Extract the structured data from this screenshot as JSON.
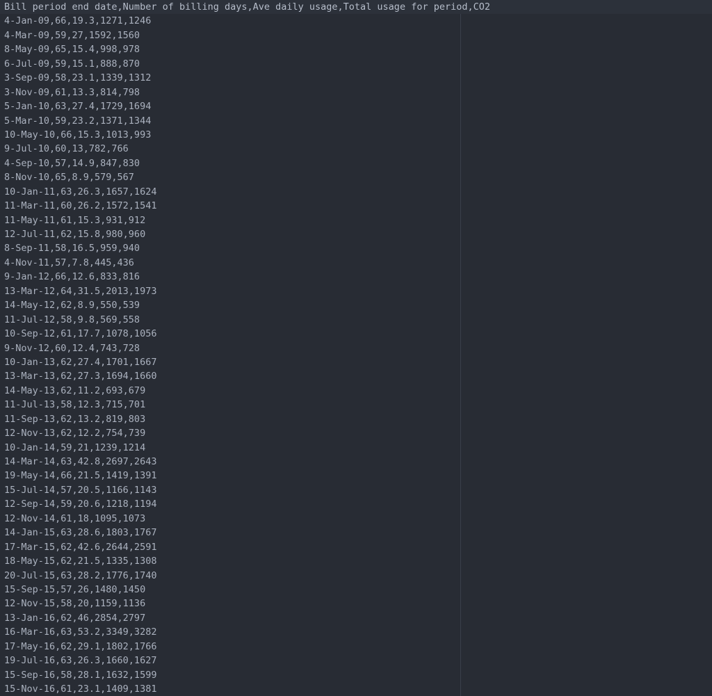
{
  "file": {
    "header": "Bill period end date,Number of billing days,Ave daily usage,Total usage for period,CO2",
    "rows": [
      "4-Jan-09,66,19.3,1271,1246",
      "4-Mar-09,59,27,1592,1560",
      "8-May-09,65,15.4,998,978",
      "6-Jul-09,59,15.1,888,870",
      "3-Sep-09,58,23.1,1339,1312",
      "3-Nov-09,61,13.3,814,798",
      "5-Jan-10,63,27.4,1729,1694",
      "5-Mar-10,59,23.2,1371,1344",
      "10-May-10,66,15.3,1013,993",
      "9-Jul-10,60,13,782,766",
      "4-Sep-10,57,14.9,847,830",
      "8-Nov-10,65,8.9,579,567",
      "10-Jan-11,63,26.3,1657,1624",
      "11-Mar-11,60,26.2,1572,1541",
      "11-May-11,61,15.3,931,912",
      "12-Jul-11,62,15.8,980,960",
      "8-Sep-11,58,16.5,959,940",
      "4-Nov-11,57,7.8,445,436",
      "9-Jan-12,66,12.6,833,816",
      "13-Mar-12,64,31.5,2013,1973",
      "14-May-12,62,8.9,550,539",
      "11-Jul-12,58,9.8,569,558",
      "10-Sep-12,61,17.7,1078,1056",
      "9-Nov-12,60,12.4,743,728",
      "10-Jan-13,62,27.4,1701,1667",
      "13-Mar-13,62,27.3,1694,1660",
      "14-May-13,62,11.2,693,679",
      "11-Jul-13,58,12.3,715,701",
      "11-Sep-13,62,13.2,819,803",
      "12-Nov-13,62,12.2,754,739",
      "10-Jan-14,59,21,1239,1214",
      "14-Mar-14,63,42.8,2697,2643",
      "19-May-14,66,21.5,1419,1391",
      "15-Jul-14,57,20.5,1166,1143",
      "12-Sep-14,59,20.6,1218,1194",
      "12-Nov-14,61,18,1095,1073",
      "14-Jan-15,63,28.6,1803,1767",
      "17-Mar-15,62,42.6,2644,2591",
      "18-May-15,62,21.5,1335,1308",
      "20-Jul-15,63,28.2,1776,1740",
      "15-Sep-15,57,26,1480,1450",
      "12-Nov-15,58,20,1159,1136",
      "13-Jan-16,62,46,2854,2797",
      "16-Mar-16,63,53.2,3349,3282",
      "17-May-16,62,29.1,1802,1766",
      "19-Jul-16,63,26.3,1660,1627",
      "15-Sep-16,58,28.1,1632,1599",
      "15-Nov-16,61,23.1,1409,1381"
    ]
  },
  "theme": {
    "background": "#282c34",
    "text": "#abb2bf",
    "wrap_guide": "#3a3f4b"
  }
}
